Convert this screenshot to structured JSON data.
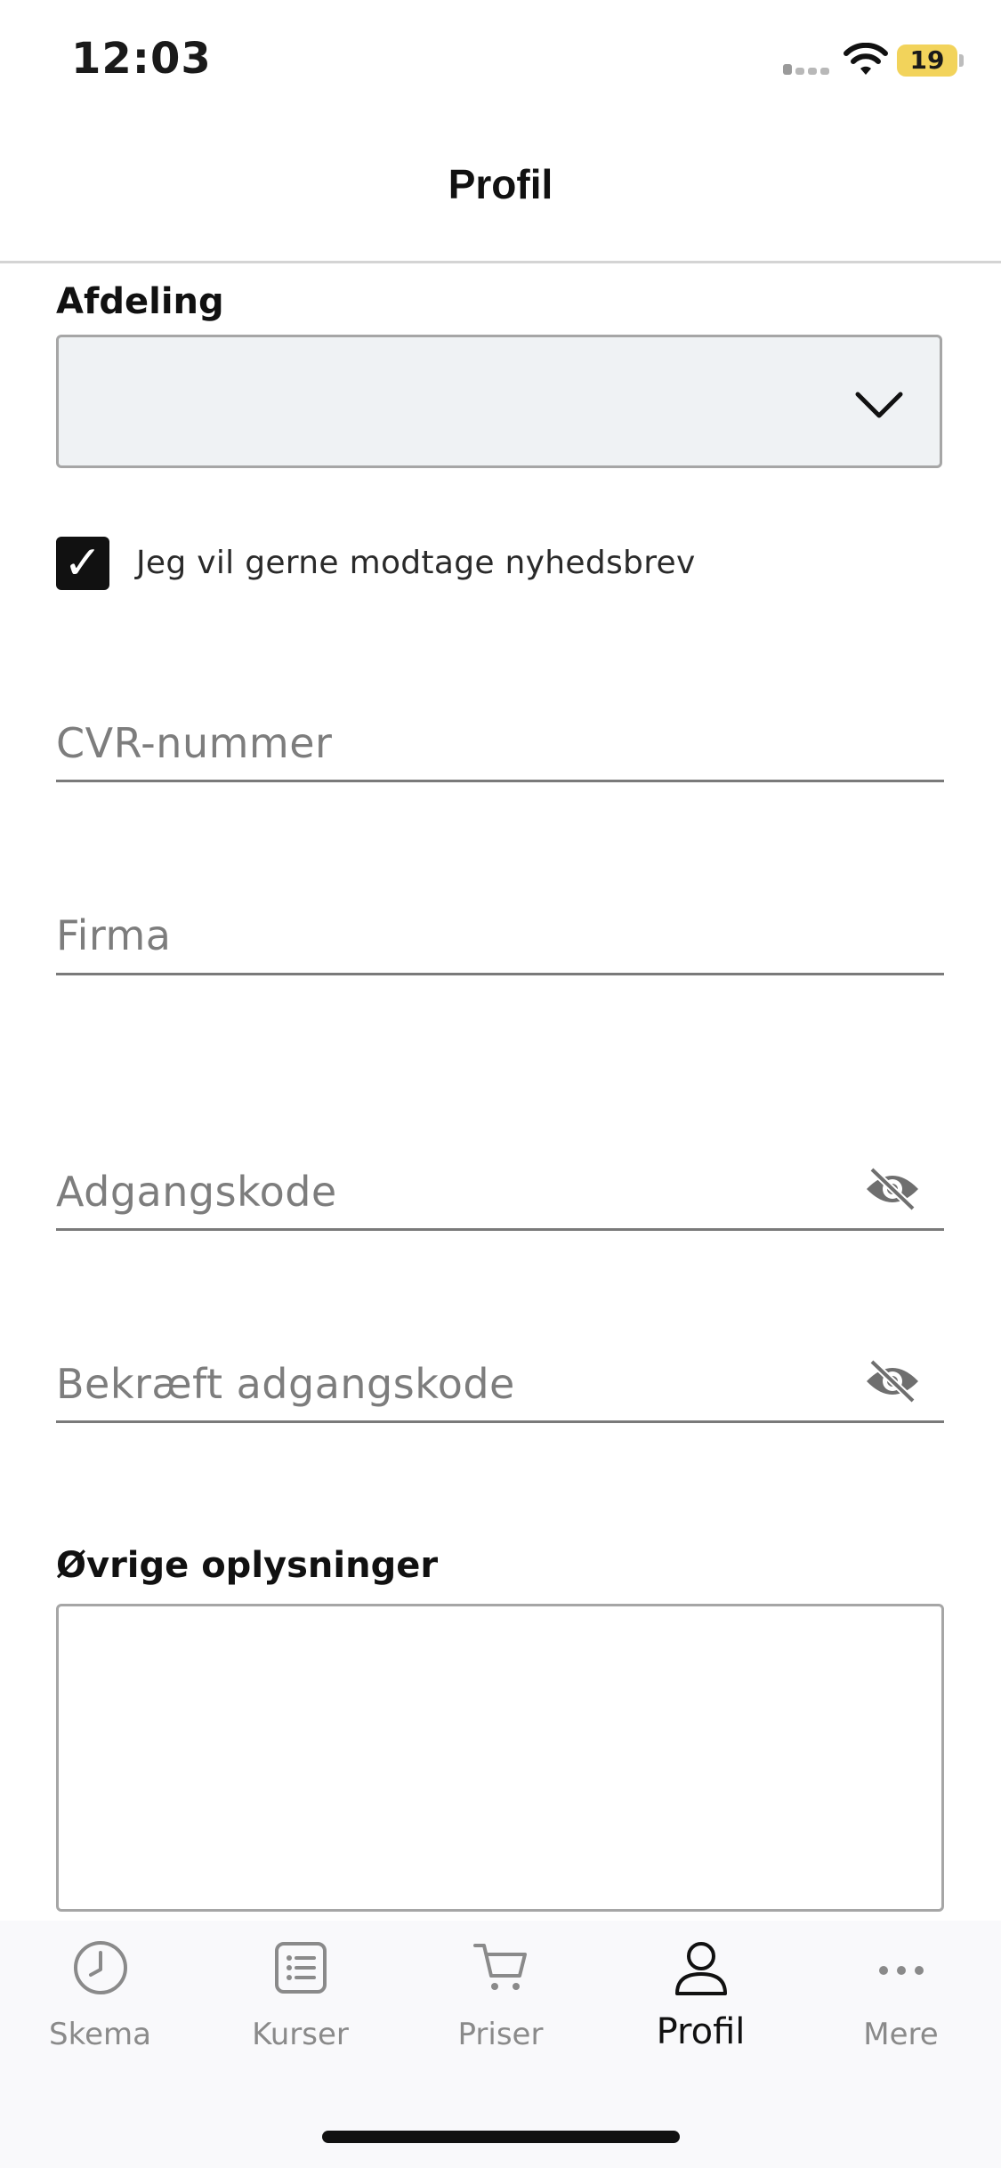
{
  "status_bar": {
    "time": "12:03",
    "battery_level": "19"
  },
  "nav": {
    "title": "Profil"
  },
  "form": {
    "afdeling_label": "Afdeling",
    "afdeling_value": "",
    "newsletter_label": "Jeg vil gerne modtage nyhedsbrev",
    "newsletter_checked": true,
    "checkmark": "✓",
    "cvr_placeholder": "CVR-nummer",
    "firma_placeholder": "Firma",
    "password_placeholder": "Adgangskode",
    "confirm_password_placeholder": "Bekræft adgangskode",
    "other_info_label": "Øvrige oplysninger",
    "other_info_value": ""
  },
  "tab_bar": {
    "tabs": [
      {
        "label": "Skema",
        "icon": "clock-icon",
        "active": false
      },
      {
        "label": "Kurser",
        "icon": "list-icon",
        "active": false
      },
      {
        "label": "Priser",
        "icon": "cart-icon",
        "active": false
      },
      {
        "label": "Profil",
        "icon": "person-icon",
        "active": true
      },
      {
        "label": "Mere",
        "icon": "more-icon",
        "active": false
      }
    ]
  },
  "colors": {
    "select_background": "#eff2f4",
    "battery": "#f2d35b",
    "inactive_tab": "#8a8a8a",
    "active_tab": "#111111"
  }
}
